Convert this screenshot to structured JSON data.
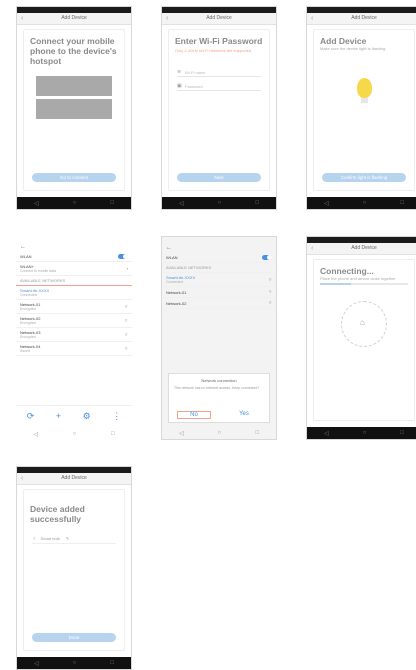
{
  "screens": {
    "s1": {
      "topbar": "Add Device",
      "title": "Connect your mobile phone to the device's hotspot",
      "button": "Go to connect"
    },
    "s2": {
      "topbar": "Add Device",
      "title": "Enter Wi-Fi Password",
      "warning": "Only 2.4GHz Wi-Fi networks are supported",
      "wifi_placeholder": "Wi-Fi name",
      "password_placeholder": "Password",
      "button": "Next"
    },
    "s3": {
      "topbar": "Add Device",
      "title": "Add Device",
      "note": "Make sure the device light is flashing",
      "button": "Confirm light is flashing"
    },
    "s4": {
      "rows": [
        {
          "label": "WLAN",
          "sub": ""
        },
        {
          "label": "WLAN+",
          "sub": "Connect to mobile data"
        },
        {
          "label": "AVAILABLE NETWORKS",
          "sub": ""
        },
        {
          "label": "SmartLife-XXXX",
          "sub": "Connected"
        },
        {
          "label": "Network-01",
          "sub": "Encrypted"
        },
        {
          "label": "Network-02",
          "sub": "Encrypted"
        },
        {
          "label": "Network-03",
          "sub": "Encrypted"
        },
        {
          "label": "Network-04",
          "sub": "Saved"
        }
      ]
    },
    "s5": {
      "rows": [
        {
          "label": "WLAN",
          "sub": ""
        },
        {
          "label": "AVAILABLE NETWORKS",
          "sub": ""
        },
        {
          "label": "SmartLife-XXXX",
          "sub": "Connected"
        },
        {
          "label": "Network-01",
          "sub": ""
        },
        {
          "label": "Network-02",
          "sub": ""
        }
      ],
      "dialog_title": "Network connection",
      "dialog_body": "This network has no Internet access. Keep connected?",
      "cancel_label": "No",
      "confirm_label": "Yes"
    },
    "s6": {
      "topbar": "Add Device",
      "title": "Connecting...",
      "note": "Place the phone and device close together",
      "progress": 0.35
    },
    "s7": {
      "topbar": "Add Device",
      "title": "Device added successfully",
      "device_name": "Smart bulb",
      "button": "Done"
    }
  },
  "colors": {
    "accent": "#4a90e2",
    "button": "#b7d4ef",
    "warning": "#f4a38a",
    "bulb": "#f7d84a"
  }
}
